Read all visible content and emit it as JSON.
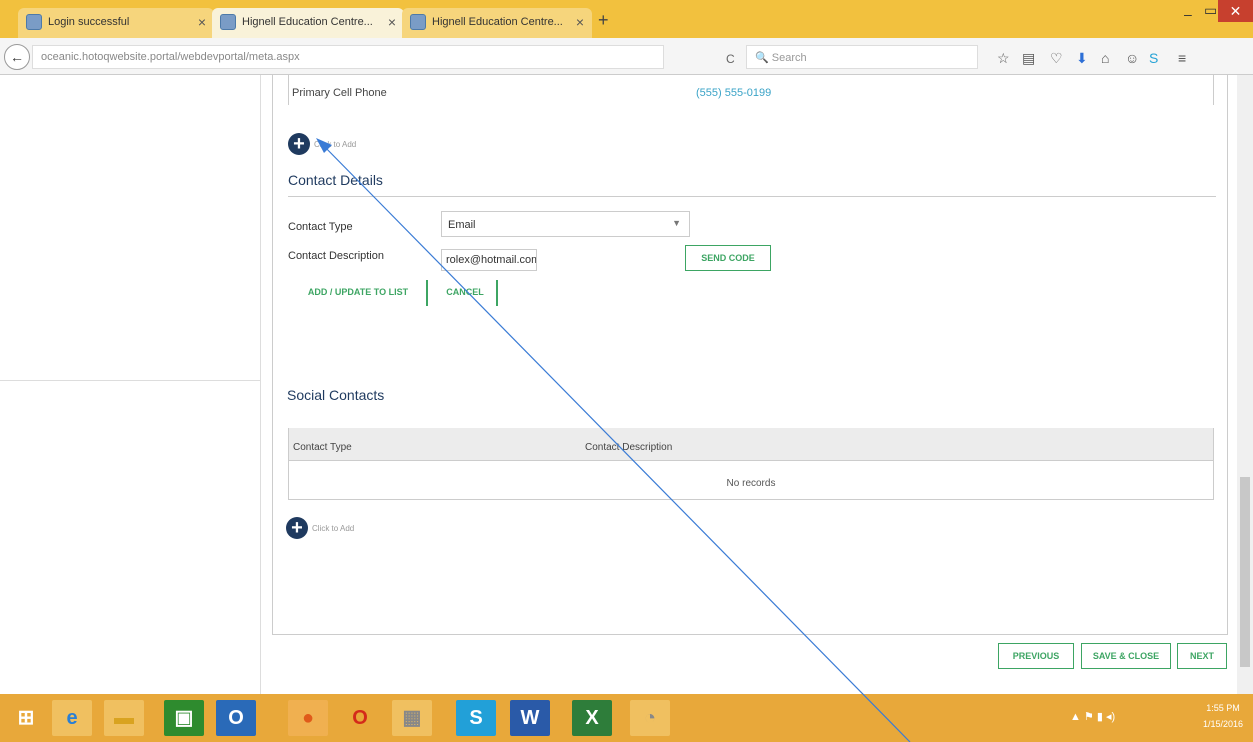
{
  "browser": {
    "tabs": [
      {
        "label": "Login successful"
      },
      {
        "label": "Hignell Education Centre..."
      },
      {
        "label": "Hignell Education Centre..."
      }
    ],
    "url": "oceanic.hotoqwebsite.portal/webdevportal/meta.aspx",
    "search_placeholder": "Search"
  },
  "form": {
    "primary_phone_label": "Primary Cell Phone",
    "primary_phone_value": "(555) 555-0199",
    "add_label": "Click to Add",
    "contact_details_title": "Contact Details",
    "contact_type_label": "Contact Type",
    "contact_type_value": "Email",
    "contact_description_label": "Contact Description",
    "contact_description_value": "rolex@hotmail.com",
    "send_code": "SEND CODE",
    "add_update": "ADD / UPDATE TO LIST",
    "cancel": "CANCEL"
  },
  "social": {
    "title": "Social Contacts",
    "col_type": "Contact Type",
    "col_description": "Contact Description",
    "empty": "No records",
    "add_label": "Click to Add"
  },
  "footer": {
    "previous": "PREVIOUS",
    "save_close": "SAVE & CLOSE",
    "next": "NEXT"
  },
  "taskbar": {
    "time": "1:55 PM",
    "date": "1/15/2016"
  }
}
